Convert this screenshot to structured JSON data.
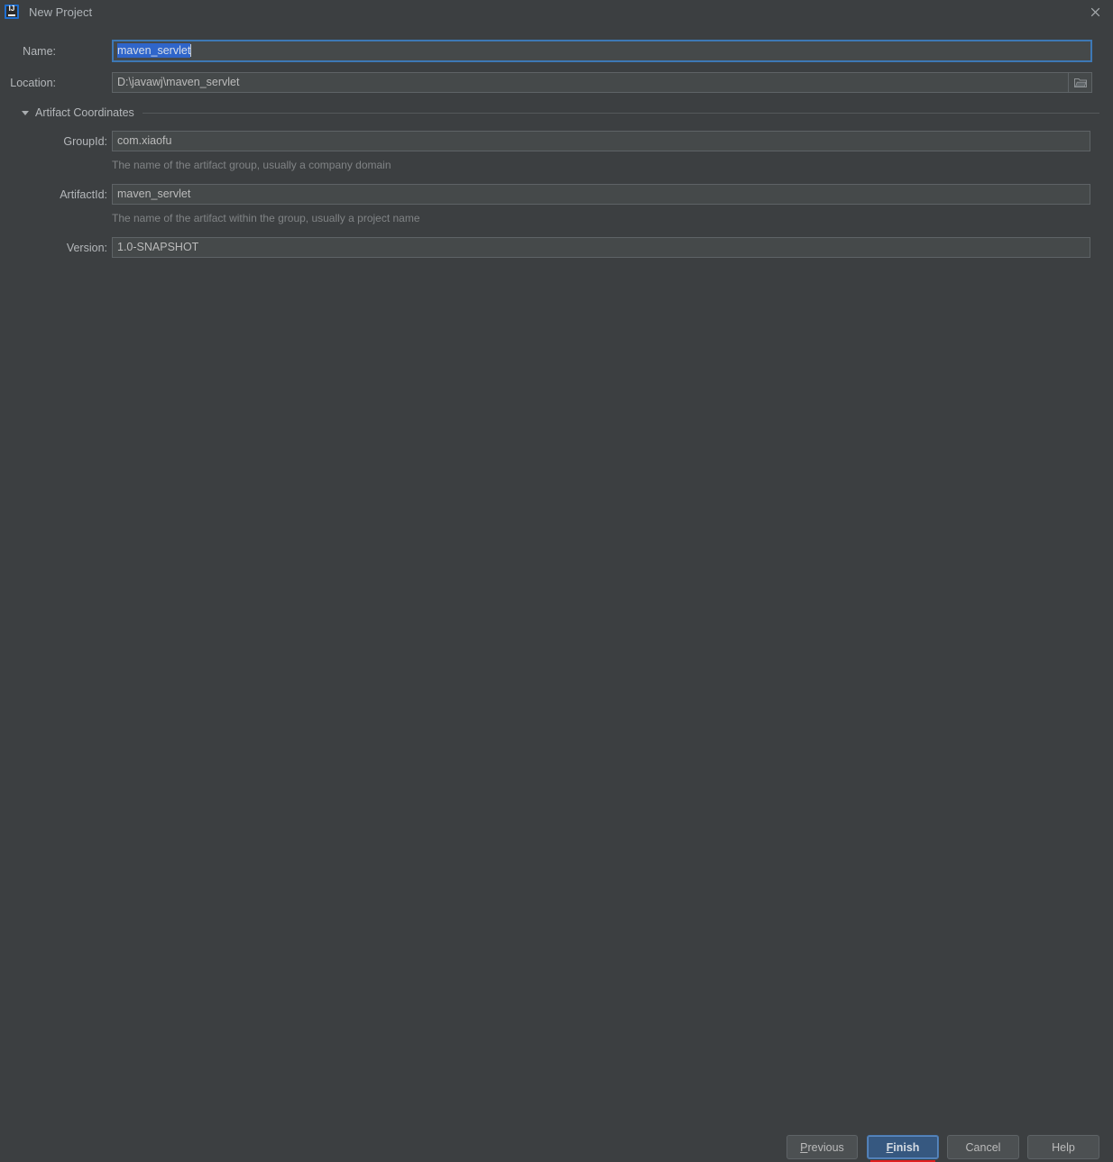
{
  "window": {
    "title": "New Project",
    "icon": "intellij-idea-icon",
    "icon_letters": "IJ",
    "close_icon": "close-icon",
    "background_color": "#3c3f41",
    "accent_color": "#365880"
  },
  "form": {
    "name": {
      "label": "Name:",
      "value": "maven_servlet",
      "selected": true,
      "focused": true
    },
    "location": {
      "label": "Location:",
      "value": "D:\\javawj\\maven_servlet",
      "browse_icon": "folder-icon"
    }
  },
  "section": {
    "title": "Artifact Coordinates",
    "expanded": true,
    "toggle_icon": "triangle-down-icon",
    "fields": [
      {
        "label": "GroupId:",
        "value": "com.xiaofu",
        "hint": "The name of the artifact group, usually a company domain",
        "name": "groupid"
      },
      {
        "label": "ArtifactId:",
        "value": "maven_servlet",
        "hint": "The name of the artifact within the group, usually a project name",
        "name": "artifactid"
      },
      {
        "label": "Version:",
        "value": "1.0-SNAPSHOT",
        "hint": "",
        "name": "version"
      }
    ]
  },
  "buttons": {
    "previous": {
      "label": "Previous",
      "mnemonic": "P",
      "rest": "revious",
      "default": false
    },
    "finish": {
      "label": "Finish",
      "mnemonic": "F",
      "rest": "inish",
      "default": true,
      "annotated": true
    },
    "cancel": {
      "label": "Cancel",
      "default": false
    },
    "help": {
      "label": "Help",
      "default": false
    }
  }
}
